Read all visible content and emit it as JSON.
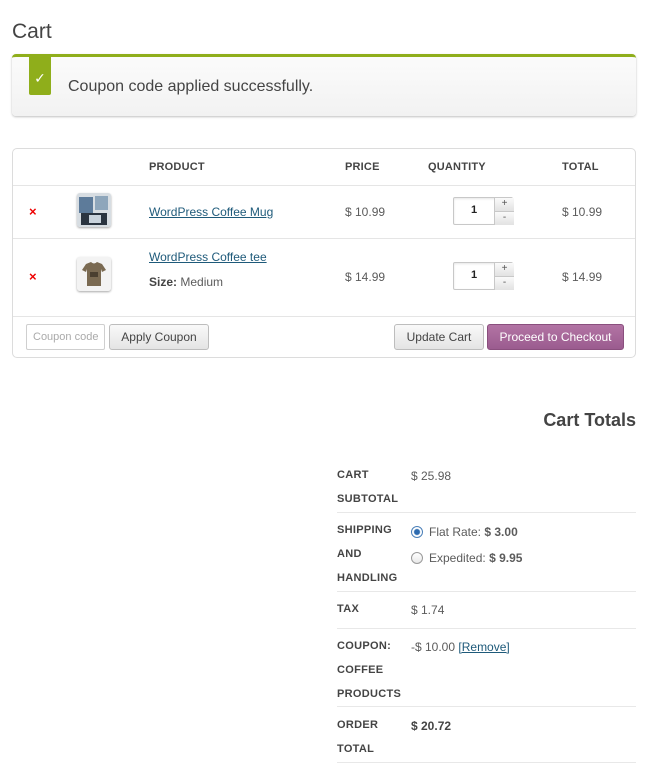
{
  "page": {
    "title": "Cart"
  },
  "notice": {
    "message": "Coupon code applied successfully."
  },
  "table": {
    "headers": {
      "product": "PRODUCT",
      "price": "PRICE",
      "quantity": "QUANTITY",
      "total": "TOTAL"
    },
    "rows": [
      {
        "name": "WordPress Coffee Mug",
        "price": "$ 10.99",
        "quantity": "1",
        "total": "$ 10.99",
        "variation_label": "",
        "variation_value": ""
      },
      {
        "name": "WordPress Coffee tee",
        "price": "$ 14.99",
        "quantity": "1",
        "total": "$ 14.99",
        "variation_label": "Size:",
        "variation_value": "Medium"
      }
    ],
    "remove_icon": "×",
    "qty_up": "+",
    "qty_down": "-"
  },
  "actions": {
    "coupon_placeholder": "Coupon code",
    "apply_label": "Apply Coupon",
    "update_label": "Update Cart",
    "checkout_label": "Proceed to Checkout"
  },
  "totals": {
    "title": "Cart Totals",
    "subtotal": {
      "label1": "CART",
      "label2": "SUBTOTAL",
      "value": "$ 25.98"
    },
    "shipping": {
      "label1": "SHIPPING",
      "label2": "AND",
      "label3": "HANDLING",
      "options": [
        {
          "name": "Flat Rate:",
          "price": "$ 3.00",
          "selected": true
        },
        {
          "name": "Expedited:",
          "price": "$ 9.95",
          "selected": false
        }
      ]
    },
    "tax": {
      "label": "TAX",
      "value": "$ 1.74"
    },
    "coupon": {
      "label1": "COUPON:",
      "label2": "COFFEE",
      "label3": "PRODUCTS",
      "value": "-$ 10.00",
      "remove": "[Remove]"
    },
    "order_total": {
      "label1": "ORDER",
      "label2": "TOTAL",
      "value": "$ 20.72"
    }
  },
  "colors": {
    "accent": "#8fae1b",
    "checkout": "#9b5c8f",
    "remove": "#e00000",
    "link": "#1e5a7a"
  }
}
